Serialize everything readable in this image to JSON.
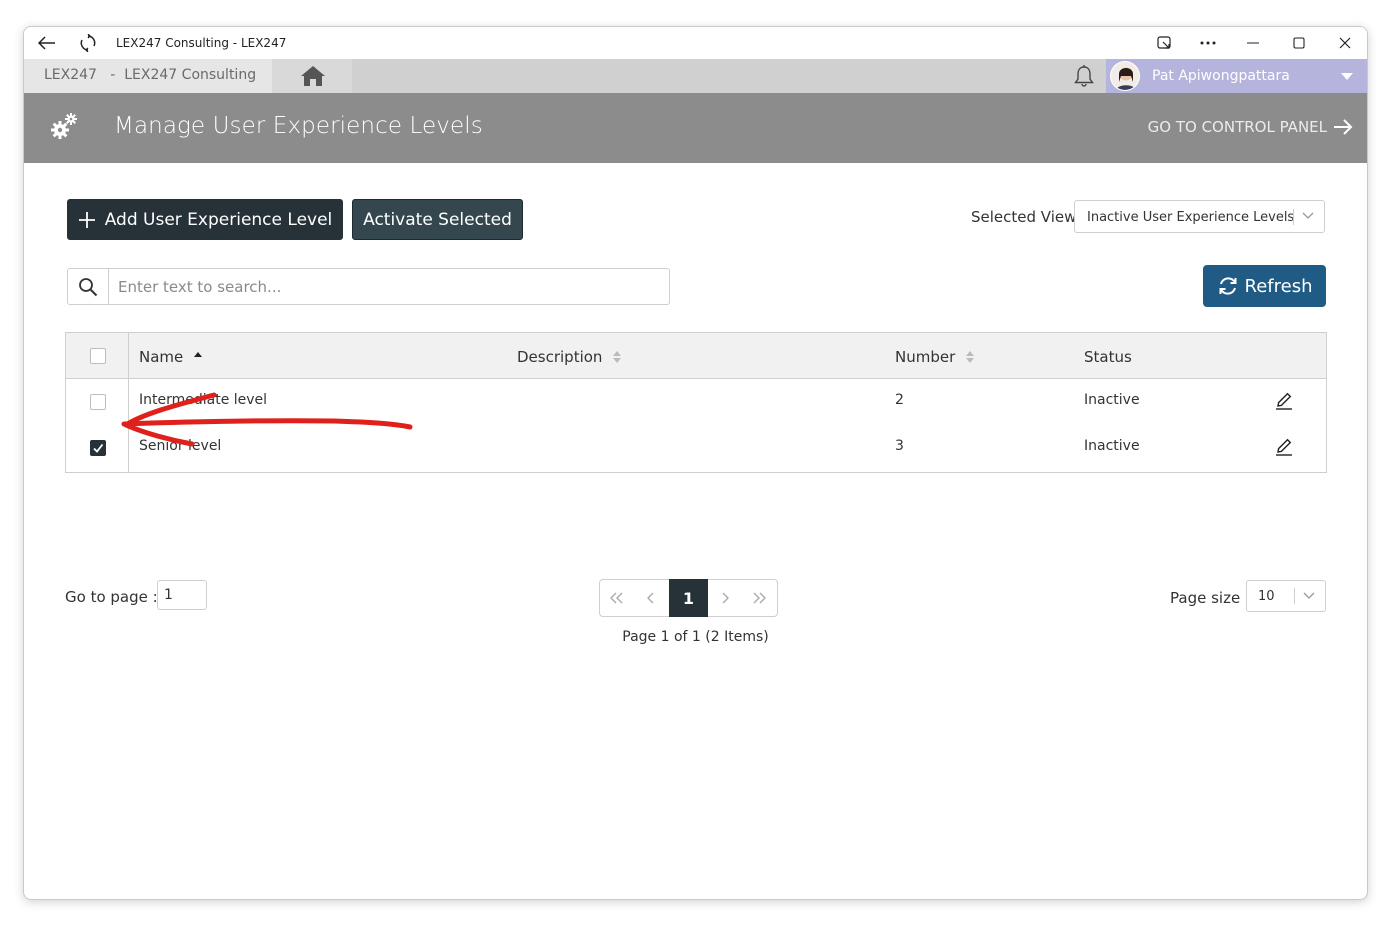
{
  "window": {
    "title": "LEX247 Consulting - LEX247"
  },
  "topnav": {
    "breadcrumb": "LEX247   -  LEX247 Consulting",
    "user_name": "Pat Apiwongpattara"
  },
  "header": {
    "title": "Manage User Experience Levels",
    "go_to_control_panel": "GO TO CONTROL PANEL"
  },
  "toolbar": {
    "add_label": "Add User Experience Level",
    "activate_label": "Activate Selected",
    "selected_view_label": "Selected View",
    "selected_view_value": "Inactive User Experience Levels",
    "refresh_label": "Refresh"
  },
  "search": {
    "placeholder": "Enter text to search..."
  },
  "grid": {
    "columns": {
      "name": "Name",
      "description": "Description",
      "number": "Number",
      "status": "Status"
    },
    "rows": [
      {
        "name": "Intermediate level",
        "description": "",
        "number": "2",
        "status": "Inactive",
        "checked": false
      },
      {
        "name": "Senior level",
        "description": "",
        "number": "3",
        "status": "Inactive",
        "checked": true
      }
    ]
  },
  "pager": {
    "goto_label": "Go to page :",
    "goto_value": "1",
    "current_page": "1",
    "info": "Page 1 of 1 (2 Items)",
    "page_size_label": "Page size :",
    "page_size_value": "10"
  },
  "colors": {
    "dark_button": "#263238",
    "refresh_button": "#1f5b85",
    "header_band": "#8c8c8c",
    "user_bar": "#b4b4dd",
    "annotation": "#e0201a"
  },
  "icons": {
    "back": "arrow-left-icon",
    "reload": "refresh-icon",
    "home": "home-icon",
    "bell": "bell-icon",
    "gears": "gears-icon",
    "search": "search-icon",
    "edit": "pencil-icon"
  }
}
